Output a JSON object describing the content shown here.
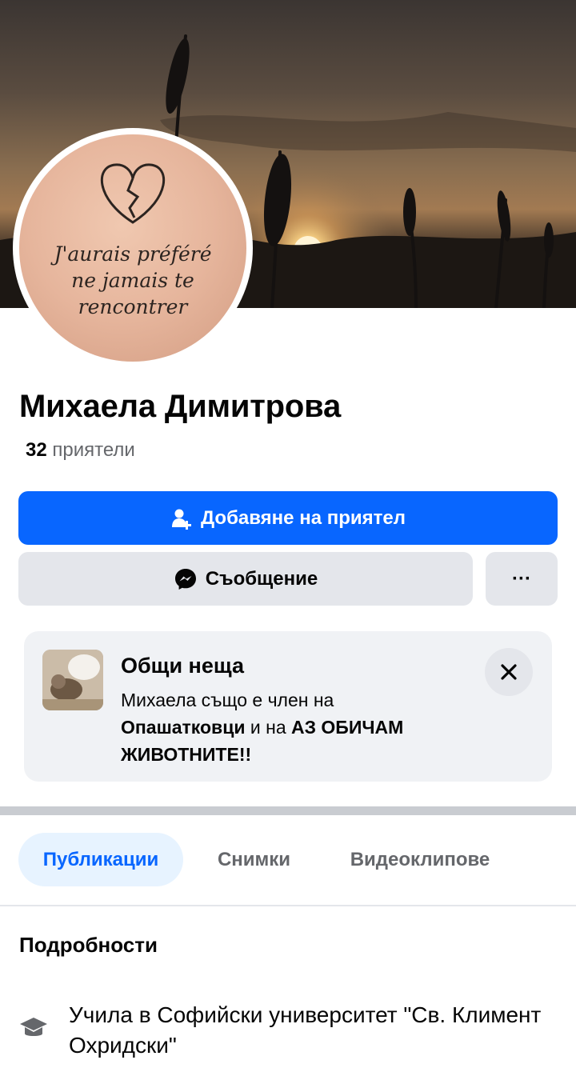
{
  "profile": {
    "name": "Михаела Димитрова",
    "friends_count": "32",
    "friends_label": "приятели",
    "tattoo_lines": [
      "J'aurais préféré",
      "ne jamais te",
      "rencontrer"
    ]
  },
  "actions": {
    "add_friend": "Добавяне на приятел",
    "message": "Съобщение",
    "more": "···"
  },
  "common": {
    "title": "Общи неща",
    "line1": "Михаела също е член на",
    "group1": "Опашатковци",
    "connector": " и на ",
    "group2": "АЗ ОБИЧАМ ЖИВОТНИТЕ!!"
  },
  "tabs": [
    {
      "label": "Публикации",
      "active": true
    },
    {
      "label": "Снимки",
      "active": false
    },
    {
      "label": "Видеоклипове",
      "active": false
    }
  ],
  "details": {
    "title": "Подробности",
    "education": "Учила в Софийски университет \"Св. Климент Охридски\""
  },
  "colors": {
    "primary": "#0866ff",
    "secondary_button": "#e4e6eb",
    "muted_text": "#65676b"
  },
  "icons": [
    "add-friend-icon",
    "messenger-icon",
    "more-icon",
    "close-icon",
    "graduation-cap-icon"
  ]
}
